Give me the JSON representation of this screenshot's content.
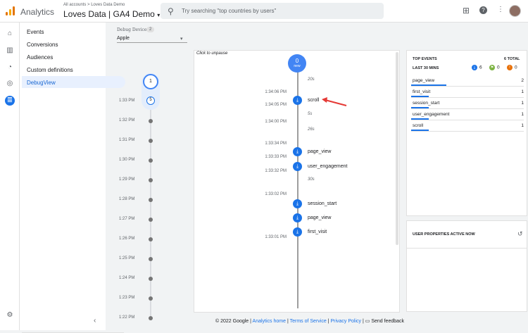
{
  "header": {
    "app_name": "Analytics",
    "breadcrumb": "All accounts > Loves Data Demo",
    "property": "Loves Data | GA4 Demo",
    "search_placeholder": "Try searching \"top countries by users\"",
    "icons": [
      "apps-icon",
      "help-icon",
      "more-vert-icon",
      "avatar"
    ]
  },
  "rail": {
    "icons": [
      "home-icon",
      "reports-icon",
      "explore-icon",
      "advertising-icon",
      "configure-icon",
      "settings-icon"
    ]
  },
  "sidenav": {
    "items": [
      {
        "label": "Events"
      },
      {
        "label": "Conversions"
      },
      {
        "label": "Audiences"
      },
      {
        "label": "Custom definitions"
      },
      {
        "label": "DebugView"
      }
    ],
    "active": "DebugView"
  },
  "device": {
    "label": "Debug Device",
    "count": "2",
    "selected": "Apple",
    "active_count": "1",
    "latest_count": "5",
    "minutes": [
      "1:33 PM",
      "1:32 PM",
      "1:31 PM",
      "1:30 PM",
      "1:29 PM",
      "1:28 PM",
      "1:27 PM",
      "1:26 PM",
      "1:25 PM",
      "1:24 PM",
      "1:23 PM",
      "1:22 PM"
    ]
  },
  "stream": {
    "unpause": "Click to unpause",
    "new_count": "0",
    "new_label": "new",
    "entries": [
      {
        "kind": "gap",
        "text": "20s"
      },
      {
        "kind": "time",
        "text": "1:34:06 PM"
      },
      {
        "kind": "event",
        "text": "scroll"
      },
      {
        "kind": "time",
        "text": "1:34:05 PM"
      },
      {
        "kind": "gap",
        "text": "5s"
      },
      {
        "kind": "time",
        "text": "1:34:00 PM"
      },
      {
        "kind": "gap",
        "text": "26s"
      },
      {
        "kind": "time",
        "text": "1:33:34 PM"
      },
      {
        "kind": "event",
        "text": "page_view"
      },
      {
        "kind": "time",
        "text": "1:33:33 PM"
      },
      {
        "kind": "event",
        "text": "user_engagement"
      },
      {
        "kind": "time",
        "text": "1:33:32 PM"
      },
      {
        "kind": "gap",
        "text": "30s"
      },
      {
        "kind": "time",
        "text": "1:33:02 PM"
      },
      {
        "kind": "event",
        "text": "session_start"
      },
      {
        "kind": "event",
        "text": "page_view"
      },
      {
        "kind": "event",
        "text": "first_visit"
      },
      {
        "kind": "time",
        "text": "1:33:01 PM"
      }
    ]
  },
  "top_events": {
    "title": "TOP EVENTS",
    "total": "6 TOTAL",
    "period": "LAST 30 MINS",
    "stats": [
      {
        "count": "6",
        "color": "#1a73e8",
        "icon": "event-icon"
      },
      {
        "count": "0",
        "color": "#7cb342",
        "icon": "conversion-icon"
      },
      {
        "count": "0",
        "color": "#e8710a",
        "icon": "error-icon"
      }
    ],
    "rows": [
      {
        "name": "page_view",
        "count": "2",
        "share": 1.0
      },
      {
        "name": "first_visit",
        "count": "1",
        "share": 0.5
      },
      {
        "name": "session_start",
        "count": "1",
        "share": 0.5
      },
      {
        "name": "user_engagement",
        "count": "1",
        "share": 0.5
      },
      {
        "name": "scroll",
        "count": "1",
        "share": 0.5
      }
    ]
  },
  "user_properties": {
    "title": "USER PROPERTIES ACTIVE NOW"
  },
  "footer": {
    "copyright": "© 2022 Google",
    "sep": " | ",
    "links": [
      "Analytics home",
      "Terms of Service",
      "Privacy Policy"
    ],
    "feedback": "Send feedback"
  }
}
